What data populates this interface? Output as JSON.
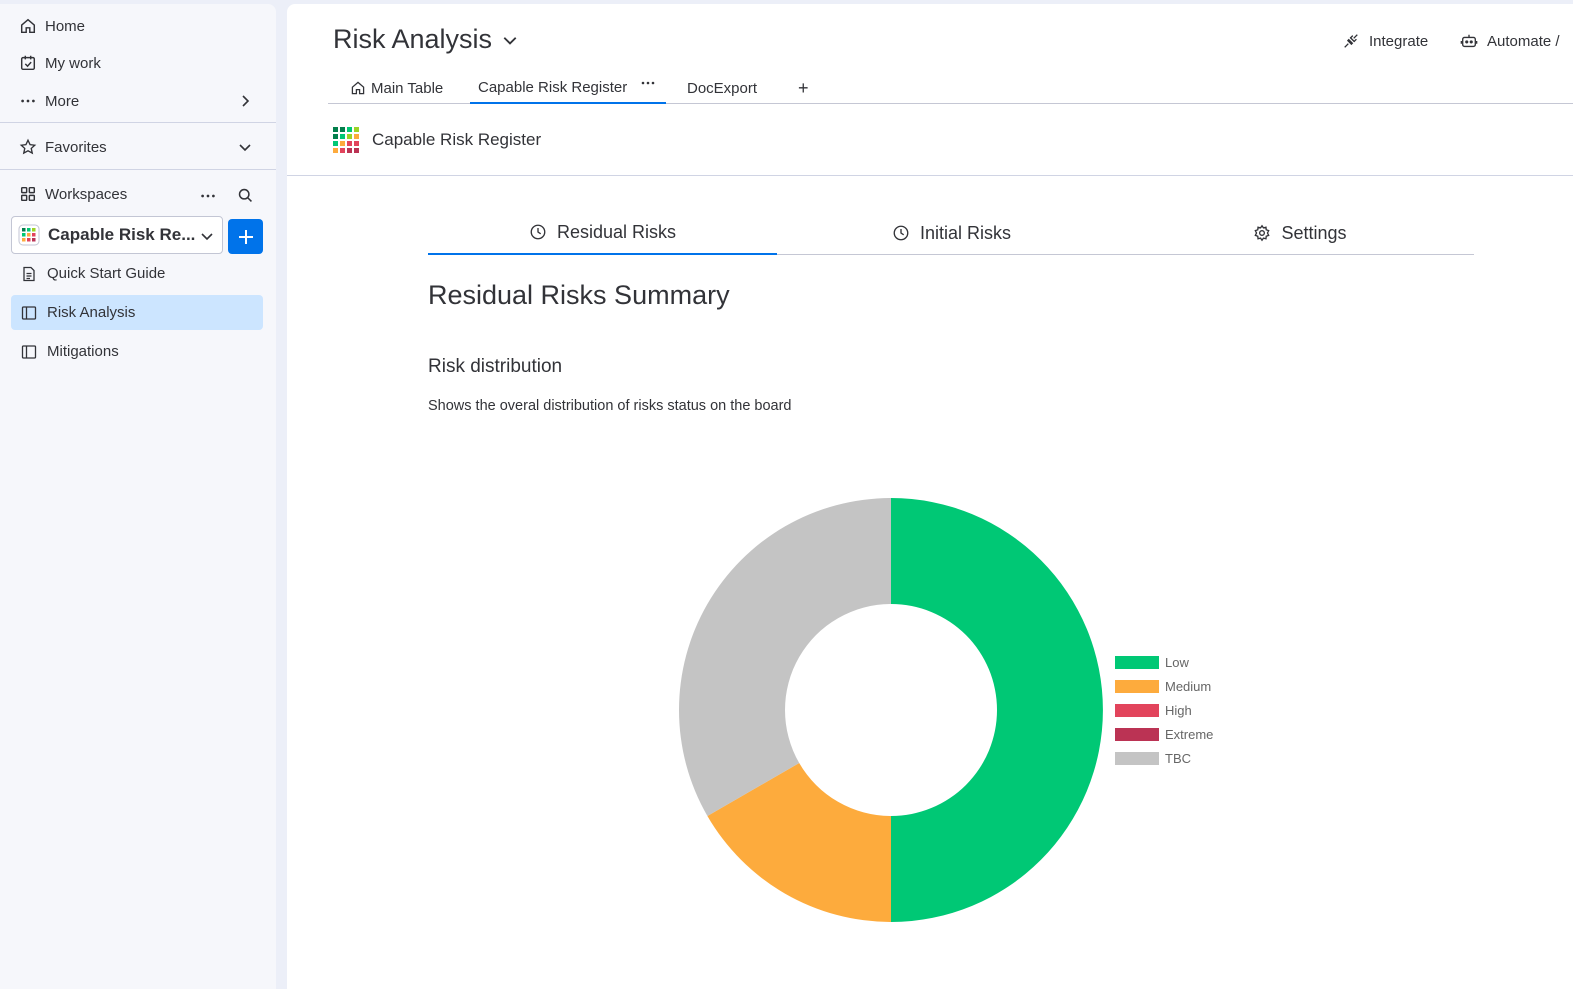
{
  "sidebar": {
    "home": "Home",
    "my_work": "My work",
    "more": "More",
    "favorites": "Favorites",
    "workspaces": "Workspaces",
    "workspace_name": "Capable Risk Re...",
    "boards": [
      {
        "label": "Quick Start Guide",
        "icon": "document-icon"
      },
      {
        "label": "Risk Analysis",
        "icon": "board-icon"
      },
      {
        "label": "Mitigations",
        "icon": "board-icon"
      }
    ]
  },
  "header": {
    "board_title": "Risk Analysis",
    "integrate": "Integrate",
    "automate": "Automate /"
  },
  "view_tabs": [
    {
      "label": "Main Table",
      "icon": "home-icon"
    },
    {
      "label": "Capable Risk Register",
      "icon": ""
    },
    {
      "label": "DocExport",
      "icon": ""
    },
    {
      "label": "+",
      "icon": ""
    }
  ],
  "board_header": {
    "app_name": "Capable Risk Register"
  },
  "widget": {
    "tabs": [
      {
        "label": "Residual Risks",
        "icon": "clock-icon"
      },
      {
        "label": "Initial Risks",
        "icon": "clock-icon"
      },
      {
        "label": "Settings",
        "icon": "gear-icon"
      }
    ],
    "summary_title": "Residual Risks Summary",
    "distribution_title": "Risk distribution",
    "distribution_desc": "Shows the overal distribution of risks status on the board"
  },
  "colors": {
    "accent": "#0073ea",
    "active_bg": "#cce5ff",
    "low": "#00c875",
    "medium": "#fdab3d",
    "high": "#e2445c",
    "extreme": "#bb3354",
    "tbc": "#c4c4c4"
  },
  "chart_data": {
    "type": "pie",
    "variant": "doughnut",
    "categories": [
      "Low",
      "Medium",
      "High",
      "Extreme",
      "TBC"
    ],
    "values": [
      3,
      1,
      0,
      0,
      2
    ],
    "colors": [
      "#00c875",
      "#fdab3d",
      "#e2445c",
      "#bb3354",
      "#c4c4c4"
    ],
    "legend": "right"
  }
}
